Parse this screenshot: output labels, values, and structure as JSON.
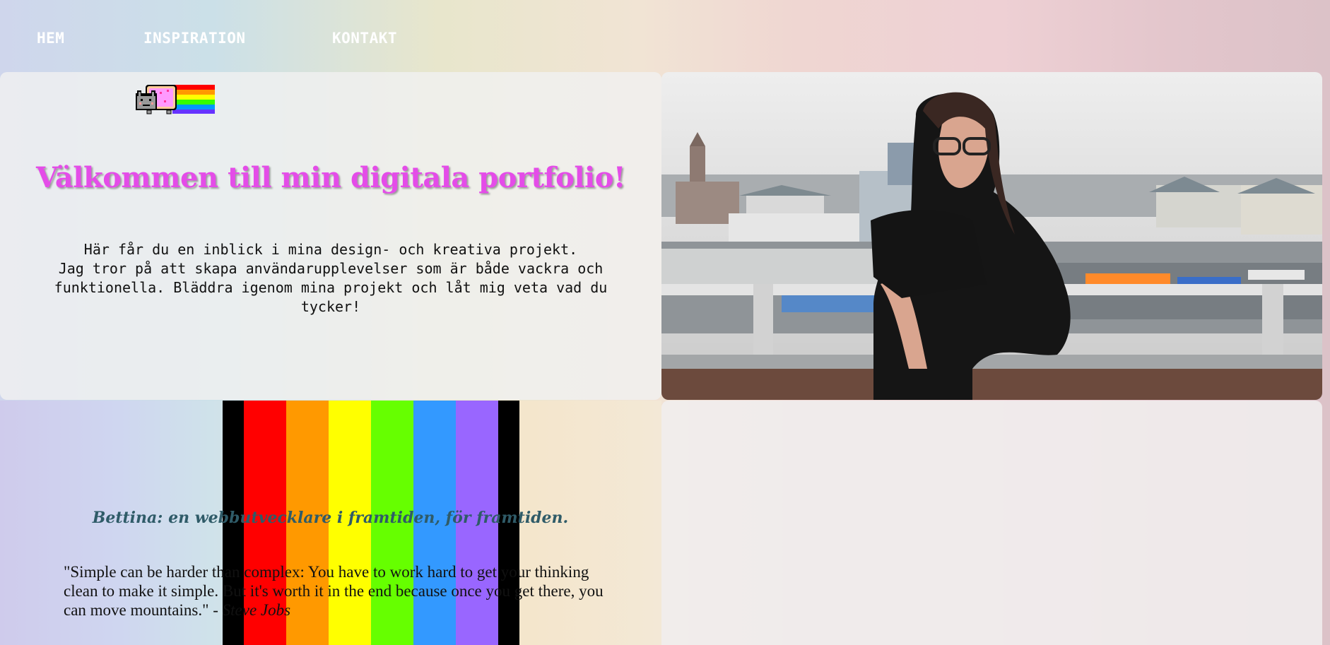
{
  "nav": {
    "items": [
      {
        "label": "HEM"
      },
      {
        "label": "INSPIRATION"
      },
      {
        "label": "KONTAKT"
      }
    ]
  },
  "intro": {
    "heading": "Välkommen till min digitala portfolio!",
    "line1": "Här får du en inblick i mina design- och kreativa projekt.",
    "line2": "Jag tror på att skapa användarupplevelser som är både vackra och funktionella. Bläddra igenom mina projekt och låt mig veta vad du tycker!"
  },
  "rainbow": {
    "colors": [
      "#000000",
      "#ff0000",
      "#ff9900",
      "#ffff00",
      "#66ff00",
      "#3399ff",
      "#9966ff",
      "#000000"
    ]
  },
  "about": {
    "tagline": "Bettina: en webbutvecklare i framtiden, för framtiden.",
    "quote": "\"Simple can be harder than complex: You have to work hard to get your thinking clean to make it simple. But it's worth it in the end because once you get there, you can move mountains.\" - ",
    "quote_author": "Steve Jobs"
  },
  "icons": {
    "nyan": "nyan-cat-icon"
  }
}
